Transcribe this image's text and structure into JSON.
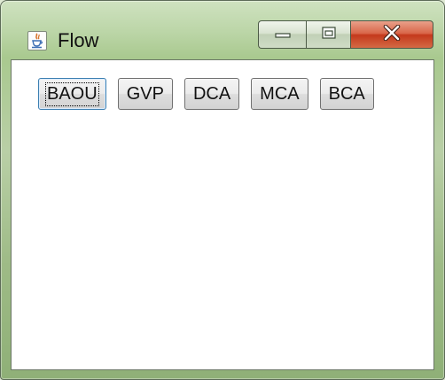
{
  "window": {
    "title": "Flow",
    "app_icon": "java-cup-icon"
  },
  "caption_buttons": {
    "minimize_icon": "minimize-icon",
    "maximize_icon": "maximize-icon",
    "close_icon": "close-icon"
  },
  "buttons": [
    {
      "label": "BAOU",
      "focused": true
    },
    {
      "label": "GVP",
      "focused": false
    },
    {
      "label": "DCA",
      "focused": false
    },
    {
      "label": "MCA",
      "focused": false
    },
    {
      "label": "BCA",
      "focused": false
    }
  ],
  "colors": {
    "title_bar": "#b9cfa6",
    "close_button": "#c4391c",
    "client_background": "#ffffff",
    "focus_border": "#3c7fb1"
  }
}
